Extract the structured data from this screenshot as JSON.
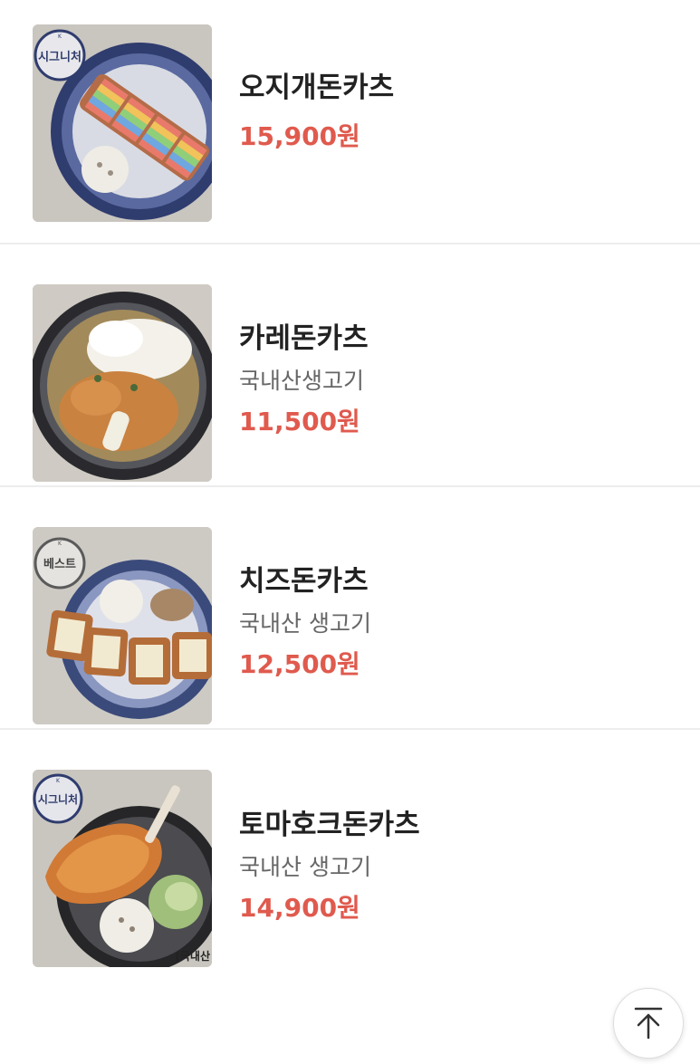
{
  "menu": {
    "items": [
      {
        "name": "오지개돈카츠",
        "description": "",
        "price": "15,900원",
        "badge": "시그니처",
        "badge_mark": "K",
        "image_icon": "rainbow-cutlet-photo"
      },
      {
        "name": "카레돈카츠",
        "description": "국내산생고기",
        "price": "11,500원",
        "badge": "",
        "badge_mark": "",
        "image_icon": "curry-cutlet-photo"
      },
      {
        "name": "치즈돈카츠",
        "description": "국내산 생고기",
        "price": "12,500원",
        "badge": "베스트",
        "badge_mark": "K",
        "image_icon": "cheese-cutlet-photo"
      },
      {
        "name": "토마호크돈카츠",
        "description": "국내산 생고기",
        "price": "14,900원",
        "badge": "시그니처",
        "badge_mark": "K",
        "photo_caption": "(국내산",
        "image_icon": "tomahawk-cutlet-photo"
      }
    ]
  },
  "scroll_top_button": {
    "icon": "arrow-up-to-line-icon"
  },
  "colors": {
    "price": "#e05a4e",
    "name": "#222222",
    "description": "#666666",
    "divider": "#ededed"
  }
}
